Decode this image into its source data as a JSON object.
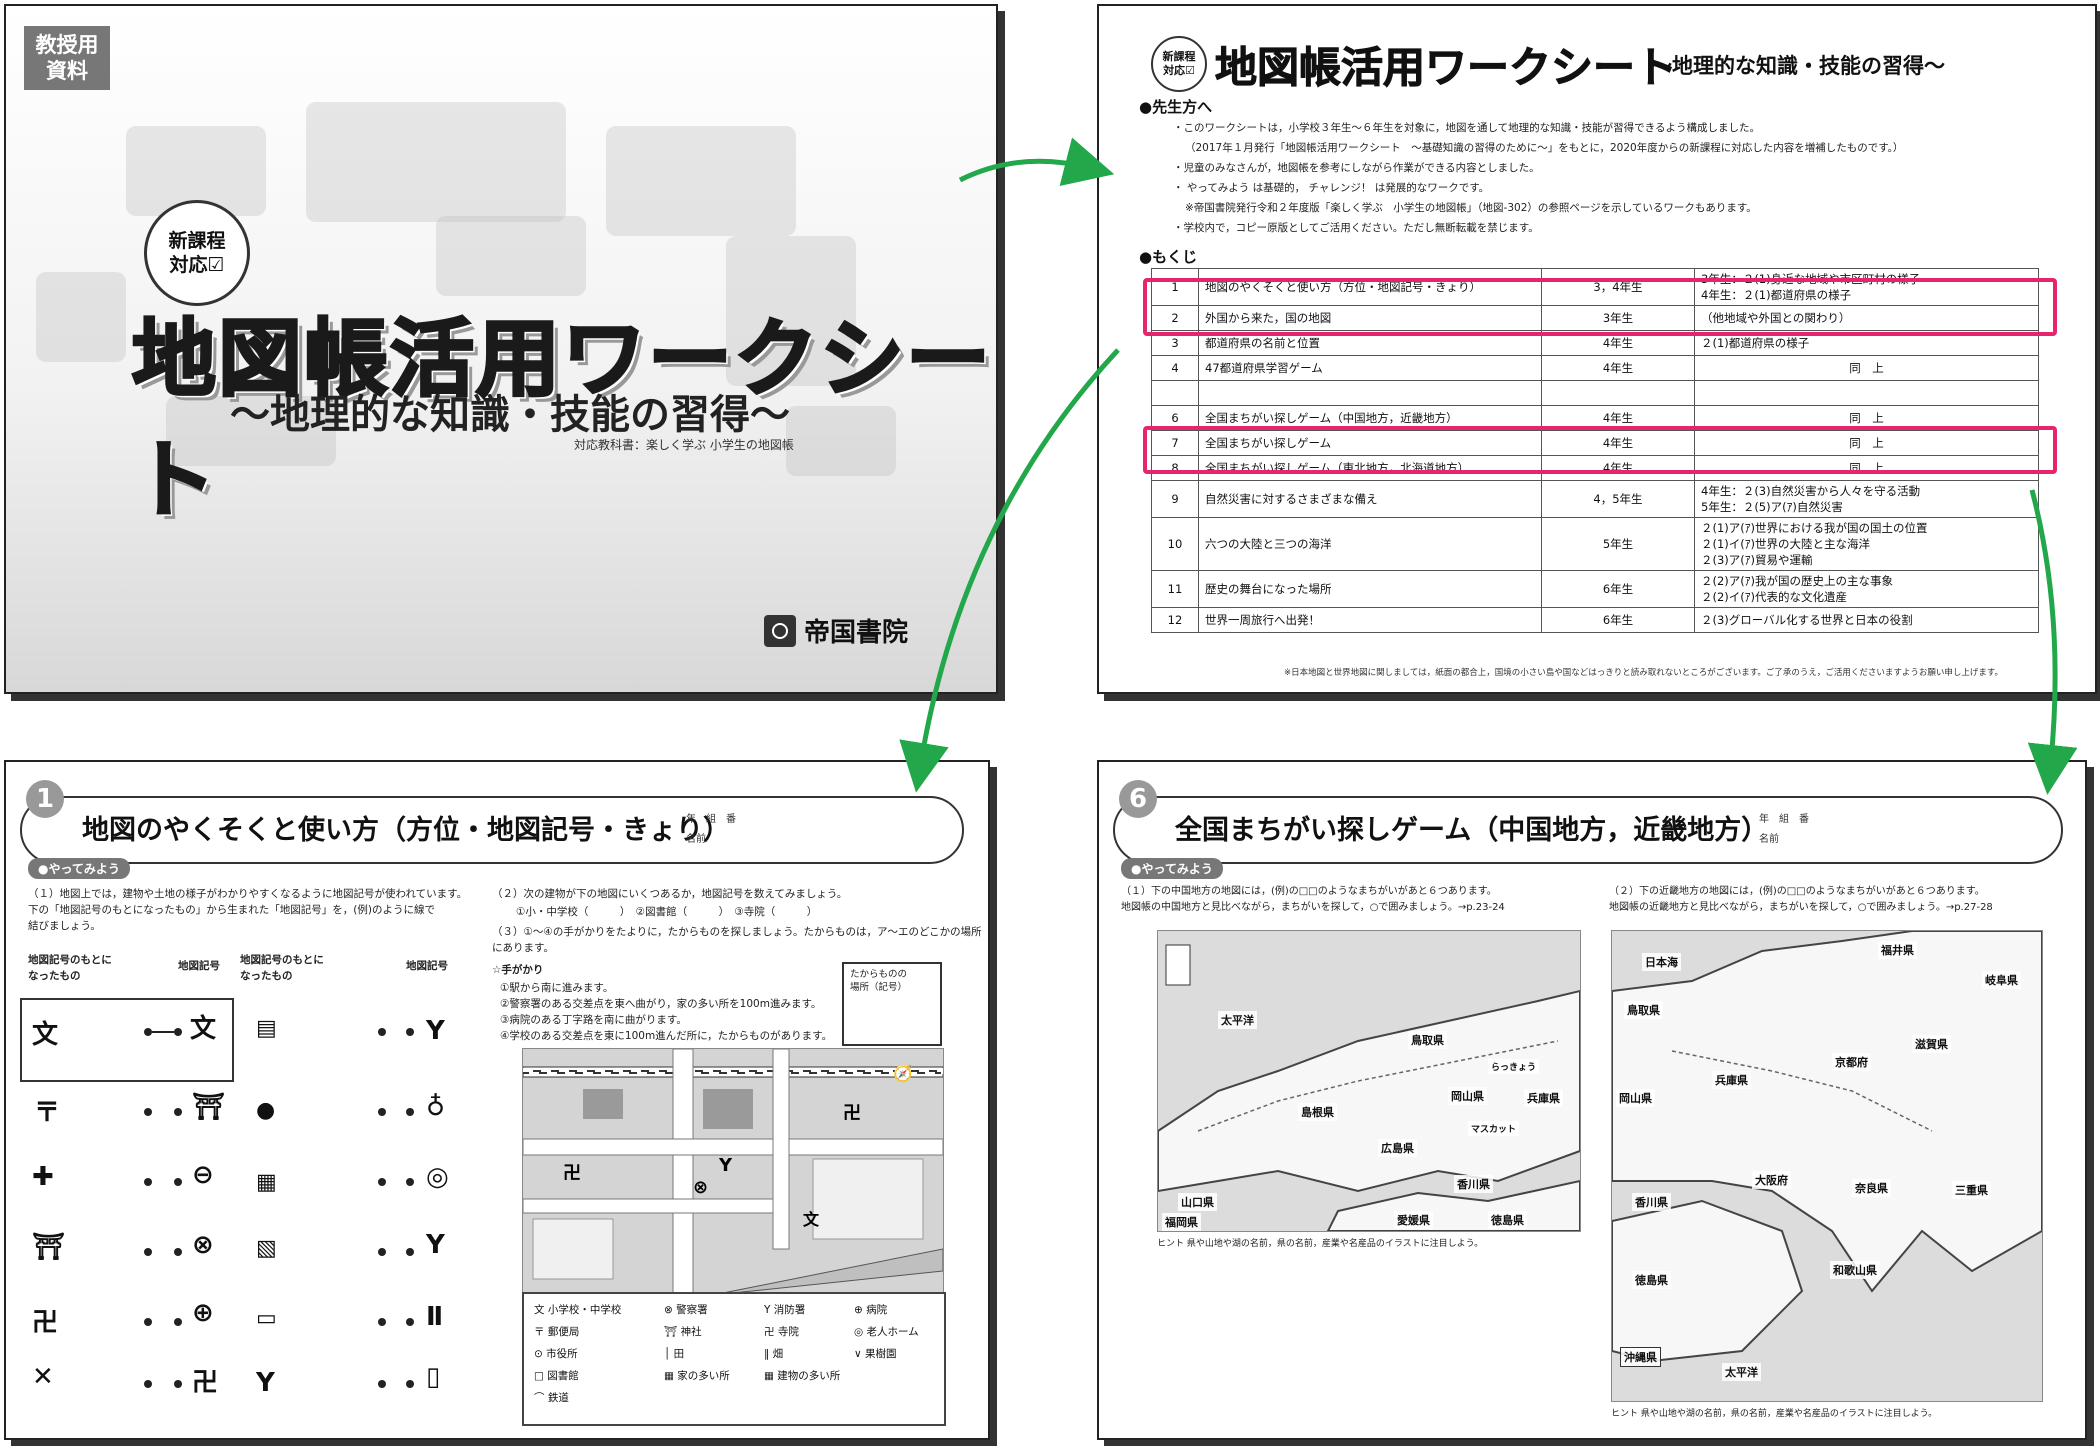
{
  "cover": {
    "tag": "教授用\n資料",
    "badge": "新課程\n対応☑",
    "title": "地図帳活用ワークシート",
    "subtitle": "〜地理的な知識・技能の習得〜",
    "textbook_note": "対応教科書：楽しく学ぶ 小学生の地図帳",
    "publisher": "帝国書院"
  },
  "toc_page": {
    "badge": "新課程\n対応☑",
    "title": "地図帳活用ワークシート",
    "subtitle": "〜地理的な知識・技能の習得〜",
    "teachers_heading": "●先生方へ",
    "teachers_lines": [
      "・このワークシートは，小学校３年生〜６年生を対象に，地図を通して地理的な知識・技能が習得できるよう構成しました。",
      "（2017年１月発行「地図帳活用ワークシート　〜基礎知識の習得のために〜」をもとに，2020年度からの新課程に対応した内容を増補したものです。）",
      "・児童のみなさんが，地図帳を参考にしながら作業ができる内容としました。",
      "・ やってみよう は基礎的， チャレンジ！ は発展的なワークです。",
      "※帝国書院発行令和２年度版「楽しく学ぶ　小学生の地図帳」（地図-302）の参照ページを示しているワークもあります。",
      "・学校内で，コピー原版としてご活用ください。ただし無断転載を禁じます。"
    ],
    "contents_heading": "●もくじ",
    "rows": [
      {
        "no": "1",
        "title": "地図のやくそくと使い方（方位・地図記号・きょり）",
        "grade": "3，4年生",
        "unit": "3年生：２(1)身近な地域や市区町村の様子\n4年生：２(1)都道府県の様子"
      },
      {
        "no": "2",
        "title": "外国から来た，国の地図",
        "grade": "3年生",
        "unit": "（他地域や外国との関わり）"
      },
      {
        "no": "3",
        "title": "都道府県の名前と位置",
        "grade": "4年生",
        "unit": "２(1)都道府県の様子"
      },
      {
        "no": "4",
        "title": "47都道府県学習ゲーム",
        "grade": "4年生",
        "unit": "同　上"
      },
      {
        "no": "",
        "title": "",
        "grade": "",
        "unit": ""
      },
      {
        "no": "6",
        "title": "全国まちがい探しゲーム（中国地方，近畿地方）",
        "grade": "4年生",
        "unit": "同　上"
      },
      {
        "no": "7",
        "title": "全国まちがい探しゲーム",
        "grade": "4年生",
        "unit": "同　上"
      },
      {
        "no": "8",
        "title": "全国まちがい探しゲーム（東北地方，北海道地方）",
        "grade": "4年生",
        "unit": "同　上"
      },
      {
        "no": "9",
        "title": "自然災害に対するさまざまな備え",
        "grade": "4，5年生",
        "unit": "4年生：２(3)自然災害から人々を守る活動\n5年生：２(5)ア(ｱ)自然災害"
      },
      {
        "no": "10",
        "title": "六つの大陸と三つの海洋",
        "grade": "5年生",
        "unit": "２(1)ア(ｱ)世界における我が国の国土の位置\n２(1)イ(ｱ)世界の大陸と主な海洋\n２(3)ア(ｱ)貿易や運輸"
      },
      {
        "no": "11",
        "title": "歴史の舞台になった場所",
        "grade": "6年生",
        "unit": "２(2)ア(ｱ)我が国の歴史上の主な事象\n２(2)イ(ｱ)代表的な文化遺産"
      },
      {
        "no": "12",
        "title": "世界一周旅行へ出発！",
        "grade": "6年生",
        "unit": "２(3)グローバル化する世界と日本の役割"
      }
    ],
    "footnote": "※日本地図と世界地図に関しましては，紙面の都合上，国境の小さい島や国などはっきりと読み取れないところがございます。ご了承のうえ，ご活用くださいますようお願い申し上げます。"
  },
  "worksheet1": {
    "number": "1",
    "title": "地図のやくそくと使い方（方位・地図記号・きょり）",
    "name_label": "年　組　番\n名前",
    "yattemiyou": "●やってみよう",
    "q1": "（１）地図上では，建物や土地の様子がわかりやすくなるように地図記号が使われています。\n下の「地図記号のもとになったもの」から生まれた「地図記号」を，(例)のように線で\n結びましょう。",
    "col_origin": "地図記号のもとに\nなったもの",
    "col_symbol": "地図記号",
    "q2": "（２）次の建物が下の地図にいくつあるか，地図記号を数えてみましょう。",
    "q2_items": "①小・中学校（　　　）　②図書館（　　　）　③寺院（　　　）",
    "q3": "（３）①〜④の手がかりをたよりに，たからものを探しましょう。たからものは，ア〜エのどこかの場所\nにあります。",
    "hint_title": "☆手がかり",
    "hints": "①駅から南に進みます。\n②警察署のある交差点を東へ曲がり，家の多い所を100m進みます。\n③病院のある丁字路を南に曲がります。\n④学校のある交差点を東に100m進んだ所に，たからものがあります。",
    "treasure_box": "たからものの\n場所（記号）",
    "legend": [
      "文 小学校・中学校",
      "⊗ 警察署",
      "Y 消防署",
      "⊕ 病院",
      "〒 郵便局",
      "⛩ 神社",
      "卍 寺院",
      "⊙ 市役所",
      "◎ 老人ホーム",
      "│ 田",
      "‖ 畑",
      "∨ 果樹園",
      "□ 図書館",
      "▦ 家の多い所",
      "▦ 建物の多い所",
      "⌒ 鉄道"
    ]
  },
  "worksheet6": {
    "number": "6",
    "title": "全国まちがい探しゲーム（中国地方，近畿地方）",
    "name_label": "年　組　番\n名前",
    "yattemiyou": "●やってみよう",
    "q1": "（１）下の中国地方の地図には，(例)の□□のようなまちがいがあと６つあります。\n地図帳の中国地方と見比べながら，まちがいを探して，○で囲みましょう。→p.23-24",
    "q2": "（２）下の近畿地方の地図には，(例)の□□のようなまちがいがあと６つあります。\n地図帳の近畿地方と見比べながら，まちがいを探して，○で囲みましょう。→p.27-28",
    "map1_places": [
      "太平洋",
      "鳥取県",
      "島根県",
      "岡山県",
      "兵庫県",
      "広島県",
      "山口県",
      "香川県",
      "愛媛県",
      "徳島県",
      "福岡県",
      "マスカット",
      "らっきょう"
    ],
    "map2_places": [
      "日本海",
      "福井県",
      "岐阜県",
      "鳥取県",
      "滋賀県",
      "兵庫県",
      "京都府",
      "岡山県",
      "大阪府",
      "奈良県",
      "三重県",
      "香川県",
      "和歌山県",
      "徳島県",
      "沖縄県",
      "太平洋"
    ],
    "map1_caption": "ヒント 県や山地や湖の名前，県の名前，産業や名産品のイラストに注目しよう。",
    "map2_caption": "ヒント 県や山地や湖の名前，県の名前，産業や名産品のイラストに注目しよう。"
  },
  "colors": {
    "highlight": "#e8246f",
    "arrow": "#22a84a"
  }
}
